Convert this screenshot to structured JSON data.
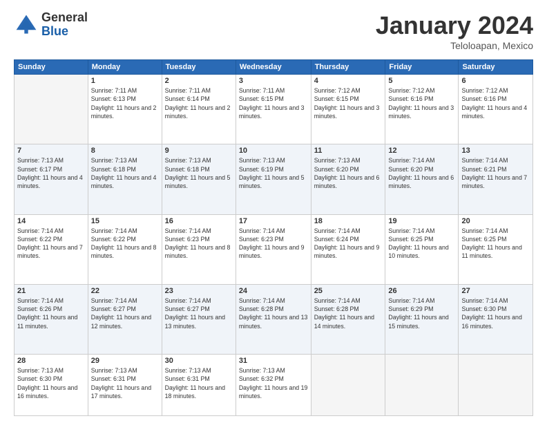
{
  "header": {
    "logo_general": "General",
    "logo_blue": "Blue",
    "title": "January 2024",
    "location": "Teloloapan, Mexico"
  },
  "weekdays": [
    "Sunday",
    "Monday",
    "Tuesday",
    "Wednesday",
    "Thursday",
    "Friday",
    "Saturday"
  ],
  "weeks": [
    [
      {
        "num": "",
        "sunrise": "",
        "sunset": "",
        "daylight": ""
      },
      {
        "num": "1",
        "sunrise": "Sunrise: 7:11 AM",
        "sunset": "Sunset: 6:13 PM",
        "daylight": "Daylight: 11 hours and 2 minutes."
      },
      {
        "num": "2",
        "sunrise": "Sunrise: 7:11 AM",
        "sunset": "Sunset: 6:14 PM",
        "daylight": "Daylight: 11 hours and 2 minutes."
      },
      {
        "num": "3",
        "sunrise": "Sunrise: 7:11 AM",
        "sunset": "Sunset: 6:15 PM",
        "daylight": "Daylight: 11 hours and 3 minutes."
      },
      {
        "num": "4",
        "sunrise": "Sunrise: 7:12 AM",
        "sunset": "Sunset: 6:15 PM",
        "daylight": "Daylight: 11 hours and 3 minutes."
      },
      {
        "num": "5",
        "sunrise": "Sunrise: 7:12 AM",
        "sunset": "Sunset: 6:16 PM",
        "daylight": "Daylight: 11 hours and 3 minutes."
      },
      {
        "num": "6",
        "sunrise": "Sunrise: 7:12 AM",
        "sunset": "Sunset: 6:16 PM",
        "daylight": "Daylight: 11 hours and 4 minutes."
      }
    ],
    [
      {
        "num": "7",
        "sunrise": "Sunrise: 7:13 AM",
        "sunset": "Sunset: 6:17 PM",
        "daylight": "Daylight: 11 hours and 4 minutes."
      },
      {
        "num": "8",
        "sunrise": "Sunrise: 7:13 AM",
        "sunset": "Sunset: 6:18 PM",
        "daylight": "Daylight: 11 hours and 4 minutes."
      },
      {
        "num": "9",
        "sunrise": "Sunrise: 7:13 AM",
        "sunset": "Sunset: 6:18 PM",
        "daylight": "Daylight: 11 hours and 5 minutes."
      },
      {
        "num": "10",
        "sunrise": "Sunrise: 7:13 AM",
        "sunset": "Sunset: 6:19 PM",
        "daylight": "Daylight: 11 hours and 5 minutes."
      },
      {
        "num": "11",
        "sunrise": "Sunrise: 7:13 AM",
        "sunset": "Sunset: 6:20 PM",
        "daylight": "Daylight: 11 hours and 6 minutes."
      },
      {
        "num": "12",
        "sunrise": "Sunrise: 7:14 AM",
        "sunset": "Sunset: 6:20 PM",
        "daylight": "Daylight: 11 hours and 6 minutes."
      },
      {
        "num": "13",
        "sunrise": "Sunrise: 7:14 AM",
        "sunset": "Sunset: 6:21 PM",
        "daylight": "Daylight: 11 hours and 7 minutes."
      }
    ],
    [
      {
        "num": "14",
        "sunrise": "Sunrise: 7:14 AM",
        "sunset": "Sunset: 6:22 PM",
        "daylight": "Daylight: 11 hours and 7 minutes."
      },
      {
        "num": "15",
        "sunrise": "Sunrise: 7:14 AM",
        "sunset": "Sunset: 6:22 PM",
        "daylight": "Daylight: 11 hours and 8 minutes."
      },
      {
        "num": "16",
        "sunrise": "Sunrise: 7:14 AM",
        "sunset": "Sunset: 6:23 PM",
        "daylight": "Daylight: 11 hours and 8 minutes."
      },
      {
        "num": "17",
        "sunrise": "Sunrise: 7:14 AM",
        "sunset": "Sunset: 6:23 PM",
        "daylight": "Daylight: 11 hours and 9 minutes."
      },
      {
        "num": "18",
        "sunrise": "Sunrise: 7:14 AM",
        "sunset": "Sunset: 6:24 PM",
        "daylight": "Daylight: 11 hours and 9 minutes."
      },
      {
        "num": "19",
        "sunrise": "Sunrise: 7:14 AM",
        "sunset": "Sunset: 6:25 PM",
        "daylight": "Daylight: 11 hours and 10 minutes."
      },
      {
        "num": "20",
        "sunrise": "Sunrise: 7:14 AM",
        "sunset": "Sunset: 6:25 PM",
        "daylight": "Daylight: 11 hours and 11 minutes."
      }
    ],
    [
      {
        "num": "21",
        "sunrise": "Sunrise: 7:14 AM",
        "sunset": "Sunset: 6:26 PM",
        "daylight": "Daylight: 11 hours and 11 minutes."
      },
      {
        "num": "22",
        "sunrise": "Sunrise: 7:14 AM",
        "sunset": "Sunset: 6:27 PM",
        "daylight": "Daylight: 11 hours and 12 minutes."
      },
      {
        "num": "23",
        "sunrise": "Sunrise: 7:14 AM",
        "sunset": "Sunset: 6:27 PM",
        "daylight": "Daylight: 11 hours and 13 minutes."
      },
      {
        "num": "24",
        "sunrise": "Sunrise: 7:14 AM",
        "sunset": "Sunset: 6:28 PM",
        "daylight": "Daylight: 11 hours and 13 minutes."
      },
      {
        "num": "25",
        "sunrise": "Sunrise: 7:14 AM",
        "sunset": "Sunset: 6:28 PM",
        "daylight": "Daylight: 11 hours and 14 minutes."
      },
      {
        "num": "26",
        "sunrise": "Sunrise: 7:14 AM",
        "sunset": "Sunset: 6:29 PM",
        "daylight": "Daylight: 11 hours and 15 minutes."
      },
      {
        "num": "27",
        "sunrise": "Sunrise: 7:14 AM",
        "sunset": "Sunset: 6:30 PM",
        "daylight": "Daylight: 11 hours and 16 minutes."
      }
    ],
    [
      {
        "num": "28",
        "sunrise": "Sunrise: 7:13 AM",
        "sunset": "Sunset: 6:30 PM",
        "daylight": "Daylight: 11 hours and 16 minutes."
      },
      {
        "num": "29",
        "sunrise": "Sunrise: 7:13 AM",
        "sunset": "Sunset: 6:31 PM",
        "daylight": "Daylight: 11 hours and 17 minutes."
      },
      {
        "num": "30",
        "sunrise": "Sunrise: 7:13 AM",
        "sunset": "Sunset: 6:31 PM",
        "daylight": "Daylight: 11 hours and 18 minutes."
      },
      {
        "num": "31",
        "sunrise": "Sunrise: 7:13 AM",
        "sunset": "Sunset: 6:32 PM",
        "daylight": "Daylight: 11 hours and 19 minutes."
      },
      {
        "num": "",
        "sunrise": "",
        "sunset": "",
        "daylight": ""
      },
      {
        "num": "",
        "sunrise": "",
        "sunset": "",
        "daylight": ""
      },
      {
        "num": "",
        "sunrise": "",
        "sunset": "",
        "daylight": ""
      }
    ]
  ]
}
